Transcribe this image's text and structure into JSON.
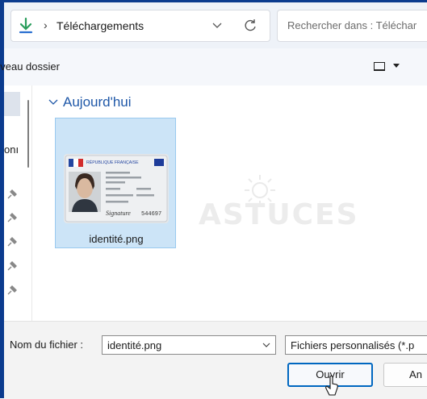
{
  "address_bar": {
    "separator": "›",
    "breadcrumb": "Téléchargements"
  },
  "search": {
    "placeholder": "Rechercher dans : Téléchar"
  },
  "toolbar": {
    "new_folder": "uveau dossier"
  },
  "nav_pane": {
    "partial_label": "onı"
  },
  "content": {
    "group_label": "Aujourd'hui",
    "files": [
      {
        "name": "identité.png",
        "selected": true
      }
    ],
    "watermark": "ASTUCES"
  },
  "thumbnail": {
    "header": "RÉPUBLIQUE FRANÇAISE",
    "signature": "Signature",
    "id_number": "544697"
  },
  "bottom": {
    "filename_label": "Nom du fichier :",
    "filename_value": "identité.png",
    "filetype_value": "Fichiers personnalisés (*.p",
    "open_button": "Ouvrir",
    "cancel_button": "An"
  },
  "colors": {
    "accent": "#0067c0",
    "selection": "#cce4f7",
    "group_header": "#1f58a8",
    "window_border": "#0b3b8e"
  }
}
